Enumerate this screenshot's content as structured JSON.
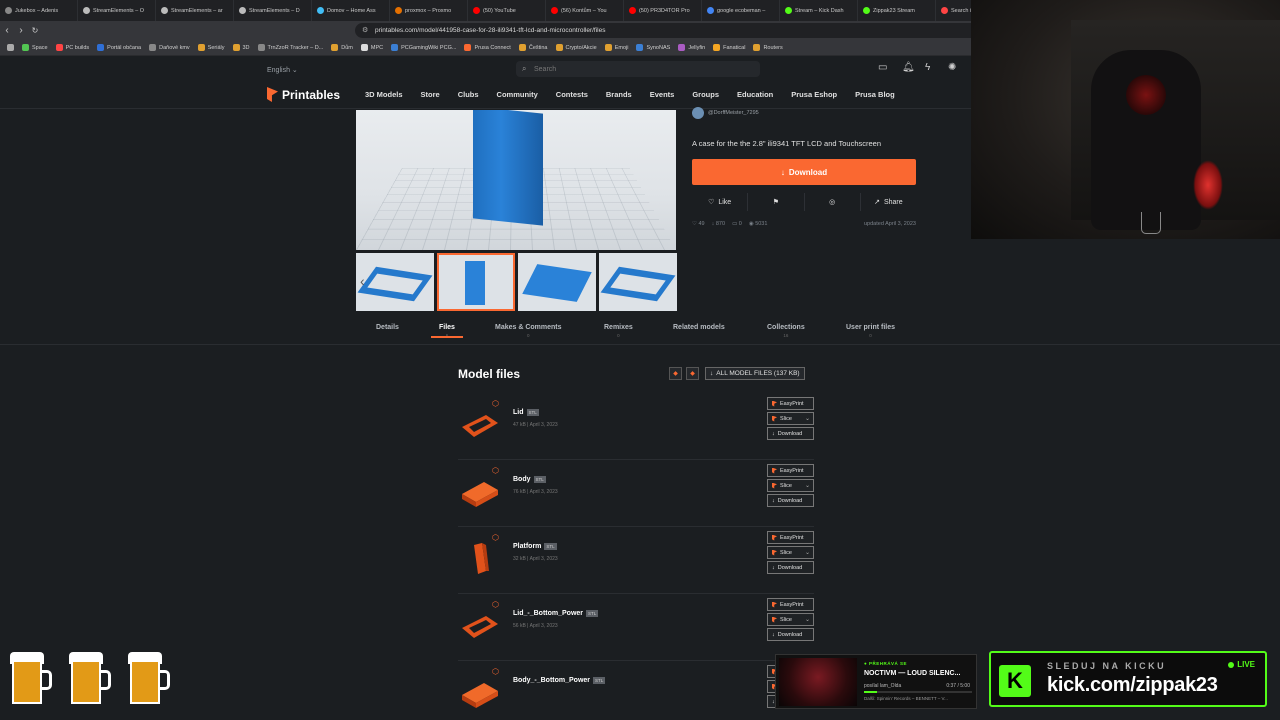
{
  "browser": {
    "tabs": [
      {
        "label": "Jukebox – Adenis",
        "color": "#888888"
      },
      {
        "label": "StreamElements – O",
        "color": "#bbbbbb"
      },
      {
        "label": "StreamElements – ar",
        "color": "#bbbbbb"
      },
      {
        "label": "StreamElements – D",
        "color": "#bbbbbb"
      },
      {
        "label": "Domov – Home Ass",
        "color": "#41bdf5"
      },
      {
        "label": "proxmox – Proxmo",
        "color": "#e57000"
      },
      {
        "label": "(50) YouTube",
        "color": "#ff0000"
      },
      {
        "label": "(56) Kontům – You",
        "color": "#ff0000"
      },
      {
        "label": "(50) PR3D4TOR Pro",
        "color": "#ff0000"
      },
      {
        "label": "google ecobeman –",
        "color": "#4285f4"
      },
      {
        "label": "Stream – Kick Dash",
        "color": "#53fc18"
      },
      {
        "label": "Zippak23 Stream",
        "color": "#53fc18"
      },
      {
        "label": "Search images",
        "color": "#ff4444"
      }
    ],
    "url": "printables.com/model/441958-case-for-28-ili9341-tft-lcd-and-microcontroller/files",
    "bookmarks": [
      {
        "label": "Space",
        "color": "#53c653"
      },
      {
        "label": "PC builds",
        "color": "#ff4444"
      },
      {
        "label": "Portál občana",
        "color": "#2f6fd6"
      },
      {
        "label": "Daňové kmv",
        "color": "#888888"
      },
      {
        "label": "Seriály",
        "color": "#e0a030"
      },
      {
        "label": "3D",
        "color": "#e0a030"
      },
      {
        "label": "TrnZzoR Tracker – D...",
        "color": "#888888"
      },
      {
        "label": "Dům",
        "color": "#e0a030"
      },
      {
        "label": "MPC",
        "color": "#dddddd"
      },
      {
        "label": "PCGamingWiki PCG...",
        "color": "#3b7fd4"
      },
      {
        "label": "Prusa Connect",
        "color": "#fa6831"
      },
      {
        "label": "Čeština",
        "color": "#e0a030"
      },
      {
        "label": "Crypto/Akcie",
        "color": "#e0a030"
      },
      {
        "label": "Emoji",
        "color": "#e0a030"
      },
      {
        "label": "SynoNAS",
        "color": "#3b7fd4"
      },
      {
        "label": "Jellyfin",
        "color": "#aa5cc3"
      },
      {
        "label": "Fanatical",
        "color": "#f5a623"
      },
      {
        "label": "Routers",
        "color": "#e0a030"
      }
    ]
  },
  "site": {
    "language": "English",
    "search_placeholder": "Search",
    "logo_text": "Printables",
    "nav": [
      "3D Models",
      "Store",
      "Clubs",
      "Community",
      "Contests",
      "Brands",
      "Events",
      "Groups",
      "Education",
      "Prusa Eshop",
      "Prusa Blog"
    ]
  },
  "model": {
    "author": "@DorffMeister_7295",
    "description": "A case for the the 2.8\" ili9341 TFT LCD and Touchscreen",
    "download_label": "Download",
    "actions": {
      "like": "Like",
      "share": "Share"
    },
    "stats": {
      "likes": "49",
      "downloads": "870",
      "comments": "0",
      "views": "5031",
      "updated": "updated April 3, 2023"
    }
  },
  "tabs": [
    {
      "label": "Details",
      "count": ""
    },
    {
      "label": "Files",
      "count": "6"
    },
    {
      "label": "Makes & Comments",
      "count": "0"
    },
    {
      "label": "Remixes",
      "count": "0"
    },
    {
      "label": "Related models",
      "count": ""
    },
    {
      "label": "Collections",
      "count": "16"
    },
    {
      "label": "User print files",
      "count": "0"
    }
  ],
  "files": {
    "title": "Model files",
    "all_label": "ALL MODEL FILES (137 KB)",
    "buttons": {
      "easyprint": "EasyPrint",
      "slice": "Slice",
      "download": "Download"
    },
    "items": [
      {
        "name": "Lid",
        "ext": "STL",
        "size": "47 kB",
        "date": "April 3, 2023"
      },
      {
        "name": "Body",
        "ext": "STL",
        "size": "76 kB",
        "date": "April 3, 2023"
      },
      {
        "name": "Platform",
        "ext": "STL",
        "size": "32 kB",
        "date": "April 3, 2023"
      },
      {
        "name": "Lid_-_Bottom_Power",
        "ext": "STL",
        "size": "56 kB",
        "date": "April 3, 2023"
      },
      {
        "name": "Body_-_Bottom_Power",
        "ext": "STL",
        "size": "",
        "date": ""
      }
    ]
  },
  "overlay": {
    "now_playing": {
      "label": "PŘEHRÁVÁ SE",
      "song": "NOCTIVM — LOUD SILENC...",
      "requested_by": "posílal lam_Olda",
      "time": "0:37 / 5:00",
      "progress": 0.12,
      "next": "Další: Spinnin' Records – BENNETT – V..."
    },
    "kick": {
      "follow_text": "SLEDUJ NA KICKU",
      "live": "LIVE",
      "url": "kick.com/zippak23"
    }
  }
}
